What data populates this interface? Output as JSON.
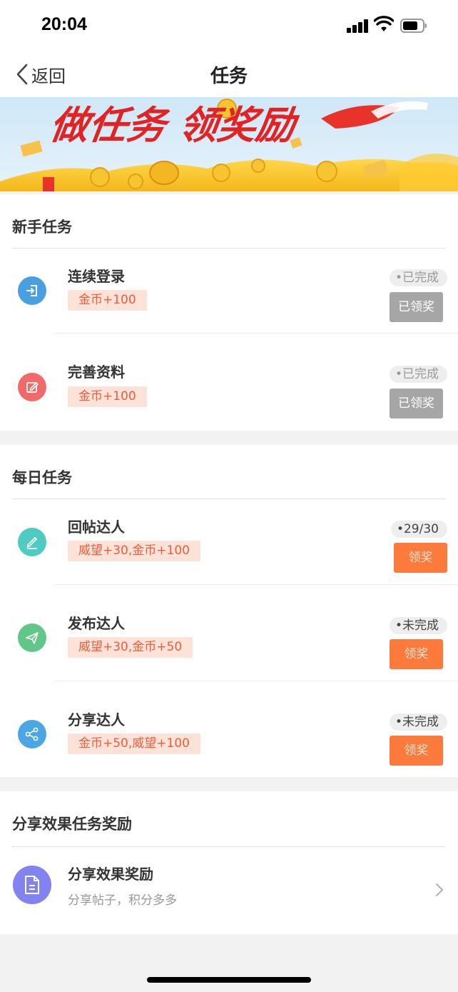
{
  "status_bar": {
    "time": "20:04"
  },
  "nav": {
    "back_label": "返回",
    "title": "任务"
  },
  "banner": {
    "headline": "做任务 领奖励"
  },
  "sections": {
    "newbie": {
      "title": "新手任务"
    },
    "daily": {
      "title": "每日任务"
    },
    "share": {
      "title": "分享效果任务奖励"
    }
  },
  "tasks": [
    {
      "name": "连续登录",
      "reward": "金币+100",
      "status": "•已完成",
      "button": "已领奖",
      "icon": "login-icon",
      "color": "#4a9fe0"
    },
    {
      "name": "完善资料",
      "reward": "金币+100",
      "status": "•已完成",
      "button": "已领奖",
      "icon": "edit-icon",
      "color": "#f16a6a"
    },
    {
      "name": "回帖达人",
      "reward": "威望+30,金币+100",
      "status": "•29/30",
      "button": "领奖",
      "icon": "reply-pen-icon",
      "color": "#4ecbc2"
    },
    {
      "name": "发布达人",
      "reward": "威望+30,金币+50",
      "status": "•未完成",
      "button": "领奖",
      "icon": "paper-plane-icon",
      "color": "#5fc787"
    },
    {
      "name": "分享达人",
      "reward": "金币+50,威望+100",
      "status": "•未完成",
      "button": "领奖",
      "icon": "share-icon",
      "color": "#4aa7e4"
    }
  ],
  "share_reward": {
    "title": "分享效果奖励",
    "subtitle": "分享帖子，积分多多",
    "icon": "document-icon",
    "color": "#8282f0"
  }
}
